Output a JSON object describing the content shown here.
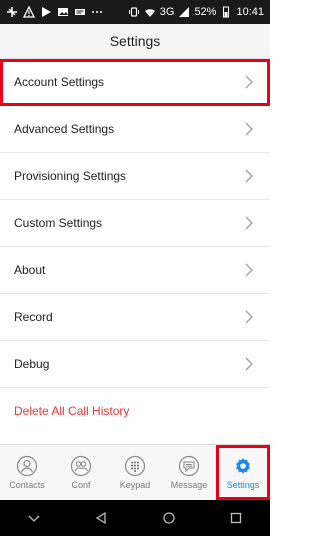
{
  "status_bar": {
    "battery": "52%",
    "time": "10:41",
    "network": "3G",
    "left_icons": [
      "plane-plus-icon",
      "warning-icon",
      "play-store-icon",
      "image-icon",
      "notification-icon",
      "more-dots-icon"
    ],
    "right_icons": [
      "vibrate-icon",
      "wifi-icon",
      "signal-icon",
      "battery-icon"
    ]
  },
  "header": {
    "title": "Settings"
  },
  "settings": {
    "items": [
      {
        "label": "Account Settings",
        "highlight": true
      },
      {
        "label": "Advanced Settings"
      },
      {
        "label": "Provisioning Settings"
      },
      {
        "label": "Custom Settings"
      },
      {
        "label": "About"
      },
      {
        "label": "Record"
      },
      {
        "label": "Debug"
      },
      {
        "label": "Delete All Call History",
        "danger": true
      }
    ],
    "chevron_icon": "chevron-right-icon"
  },
  "tabs": [
    {
      "label": "Contacts",
      "icon": "contacts-icon"
    },
    {
      "label": "Conf",
      "icon": "conference-icon"
    },
    {
      "label": "Keypad",
      "icon": "keypad-icon"
    },
    {
      "label": "Message",
      "icon": "message-icon"
    },
    {
      "label": "Settings",
      "icon": "settings-gear-icon",
      "active": true
    }
  ],
  "colors": {
    "accent": "#1e88e5",
    "highlight_border": "#e8001c",
    "danger_text": "#e53935"
  },
  "nav": {
    "buttons": [
      "collapse-icon",
      "back-icon",
      "home-icon",
      "recents-icon"
    ]
  }
}
